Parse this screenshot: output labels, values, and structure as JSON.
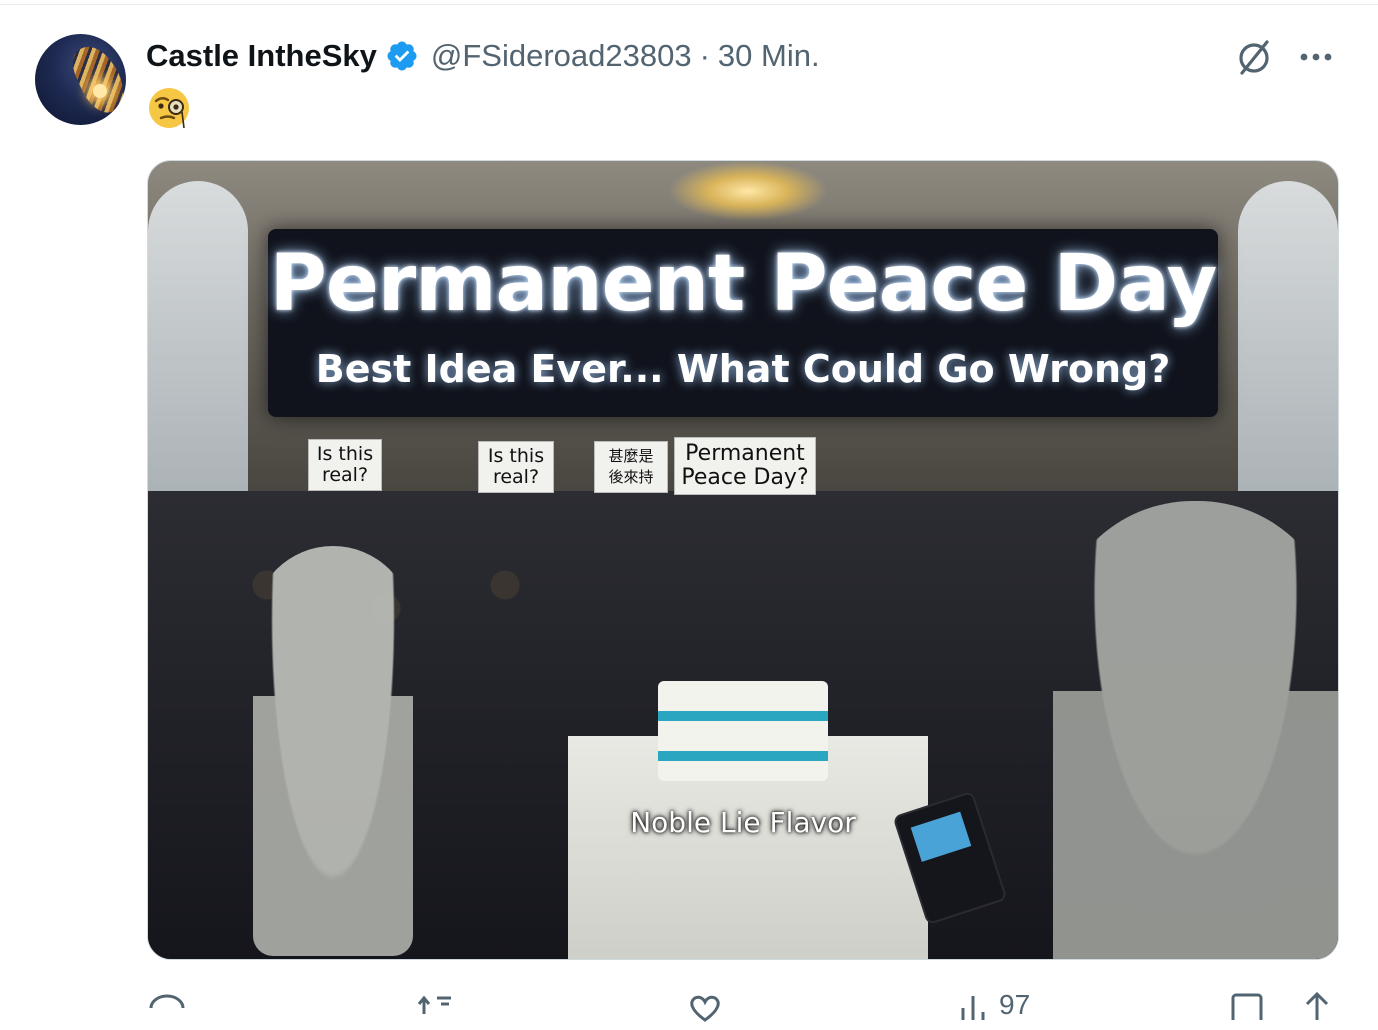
{
  "tweet": {
    "display_name": "Castle IntheSky",
    "handle": "@FSideroad23803",
    "separator": "·",
    "time": "30 Min.",
    "text_emoji": "🧐"
  },
  "media": {
    "banner_title": "Permanent Peace Day",
    "banner_subtitle": "Best Idea Ever... What Could Go Wrong?",
    "signs": [
      "Is this real?",
      "Is this real?",
      "甚麼是 後來持",
      "Permanent Peace Day?"
    ],
    "cake_label": "Noble Lie Flavor"
  },
  "actions": {
    "views_count": "97"
  },
  "colors": {
    "verified": "#1d9bf0",
    "secondary_text": "#536471",
    "primary_text": "#0f1419"
  },
  "icons": {
    "verified": "verified-badge-icon",
    "grok": "grok-icon",
    "more": "more-icon",
    "reply": "reply-icon",
    "repost": "repost-icon",
    "like": "heart-icon",
    "views": "views-icon",
    "bookmark": "bookmark-icon",
    "share": "share-icon"
  }
}
